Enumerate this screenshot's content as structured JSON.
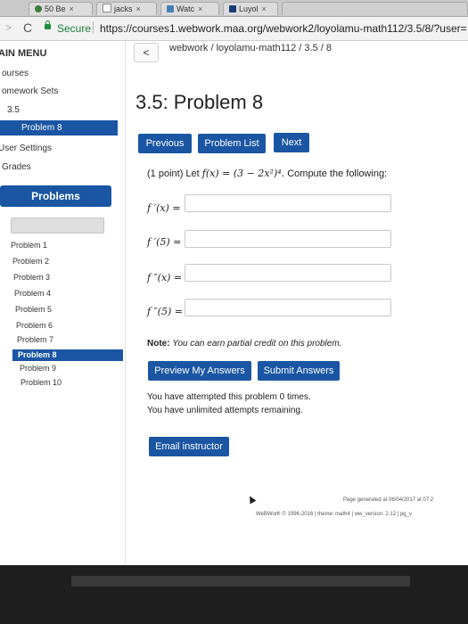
{
  "browser": {
    "tabs": [
      "50 Be",
      "jacks",
      "Watc",
      "Luyol"
    ],
    "secure_label": "Secure",
    "url": "https://courses1.webwork.maa.org/webwork2/loyolamu-math112/3.5/8/?user="
  },
  "sidebar": {
    "main_menu": "AIN MENU",
    "courses": "ourses",
    "homework_sets": "omework Sets",
    "set": "3.5",
    "current_problem": "Problem 8",
    "user_settings": "User Settings",
    "grades": "Grades",
    "problems_button": "Problems",
    "problem_list": [
      "Problem 1",
      "Problem 2",
      "Problem 3",
      "Problem 4",
      "Problem 5",
      "Problem 6",
      "Problem 7",
      "Problem 8",
      "Problem 9",
      "Problem 10"
    ],
    "active_index": 7
  },
  "header": {
    "back_label": "<",
    "breadcrumb": "webwork / loyolamu-math112 / 3.5 / 8"
  },
  "main": {
    "title": "3.5: Problem 8",
    "nav": {
      "previous": "Previous",
      "problem_list": "Problem List",
      "next": "Next"
    },
    "problem_intro": "(1 point) Let",
    "function_expr": "f(x) = (3 − 2x²)⁴.",
    "problem_tail": "Compute the following:",
    "questions": [
      "f ′(x) =",
      "f ′(5) =",
      "f ″(x) =",
      "f ″(5) ="
    ],
    "note_label": "Note:",
    "note_text": "You can earn partial credit on this problem.",
    "preview_button": "Preview My Answers",
    "submit_button": "Submit Answers",
    "attempts_line": "You have attempted this problem 0 times.",
    "unlimited_line": "You have unlimited attempts remaining.",
    "email_button": "Email instructor"
  },
  "footer": {
    "generated": "Page generated at 06/04/2017 at 07:2",
    "credits": "WeBWorK © 1996-2016 | theme: math4 | ww_version: 2.12 | pg_v"
  },
  "colors": {
    "accent": "#1a56a3"
  }
}
